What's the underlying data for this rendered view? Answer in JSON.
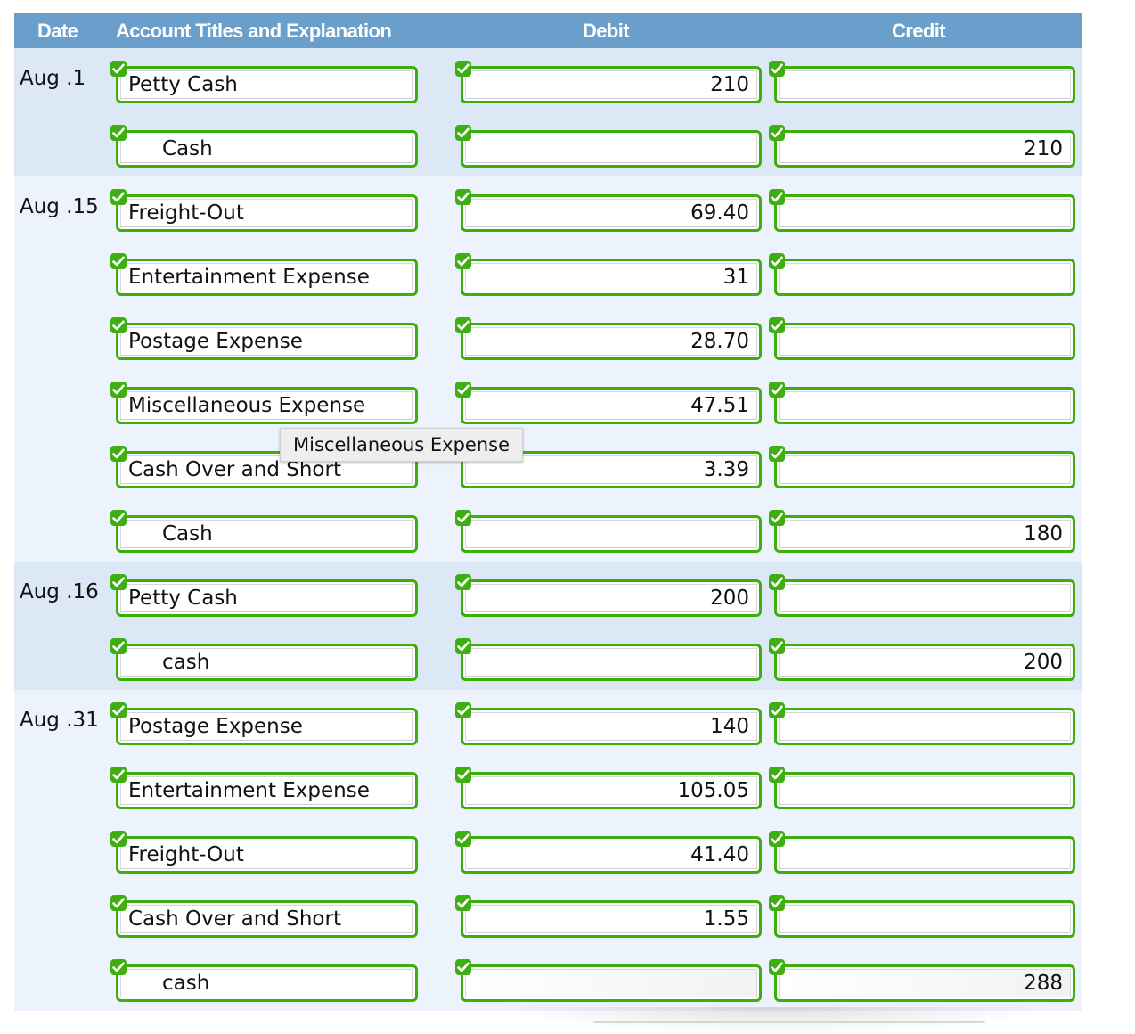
{
  "header": {
    "date": "Date",
    "account": "Account Titles and Explanation",
    "debit": "Debit",
    "credit": "Credit"
  },
  "status_icon": "check-icon",
  "colors": {
    "header_bg": "#6a9fcb",
    "group_bg_a": "#dde8f7",
    "group_bg_b": "#edf3fc",
    "correct_border": "#3caf0c"
  },
  "entries": [
    {
      "date": "Aug .1",
      "lines": [
        {
          "account": "Petty Cash",
          "debit": "210",
          "credit": "",
          "indent": false
        },
        {
          "account": "Cash",
          "debit": "",
          "credit": "210",
          "indent": true
        }
      ]
    },
    {
      "date": "Aug .15",
      "lines": [
        {
          "account": "Freight-Out",
          "debit": "69.40",
          "credit": "",
          "indent": false
        },
        {
          "account": "Entertainment Expense",
          "debit": "31",
          "credit": "",
          "indent": false
        },
        {
          "account": "Postage Expense",
          "debit": "28.70",
          "credit": "",
          "indent": false
        },
        {
          "account": "Miscellaneous Expense",
          "debit": "47.51",
          "credit": "",
          "indent": false
        },
        {
          "account": "Cash Over and Short",
          "debit": "3.39",
          "credit": "",
          "indent": false
        },
        {
          "account": "Cash",
          "debit": "",
          "credit": "180",
          "indent": true
        }
      ]
    },
    {
      "date": "Aug .16",
      "lines": [
        {
          "account": "Petty Cash",
          "debit": "200",
          "credit": "",
          "indent": false
        },
        {
          "account": "cash",
          "debit": "",
          "credit": "200",
          "indent": true
        }
      ]
    },
    {
      "date": "Aug .31",
      "lines": [
        {
          "account": "Postage Expense",
          "debit": "140",
          "credit": "",
          "indent": false
        },
        {
          "account": "Entertainment Expense",
          "debit": "105.05",
          "credit": "",
          "indent": false
        },
        {
          "account": "Freight-Out",
          "debit": "41.40",
          "credit": "",
          "indent": false
        },
        {
          "account": "Cash Over and Short",
          "debit": "1.55",
          "credit": "",
          "indent": false
        },
        {
          "account": "cash",
          "debit": "",
          "credit": "288",
          "indent": true
        }
      ]
    }
  ],
  "tooltip": {
    "text": "Miscellaneous Expense"
  }
}
